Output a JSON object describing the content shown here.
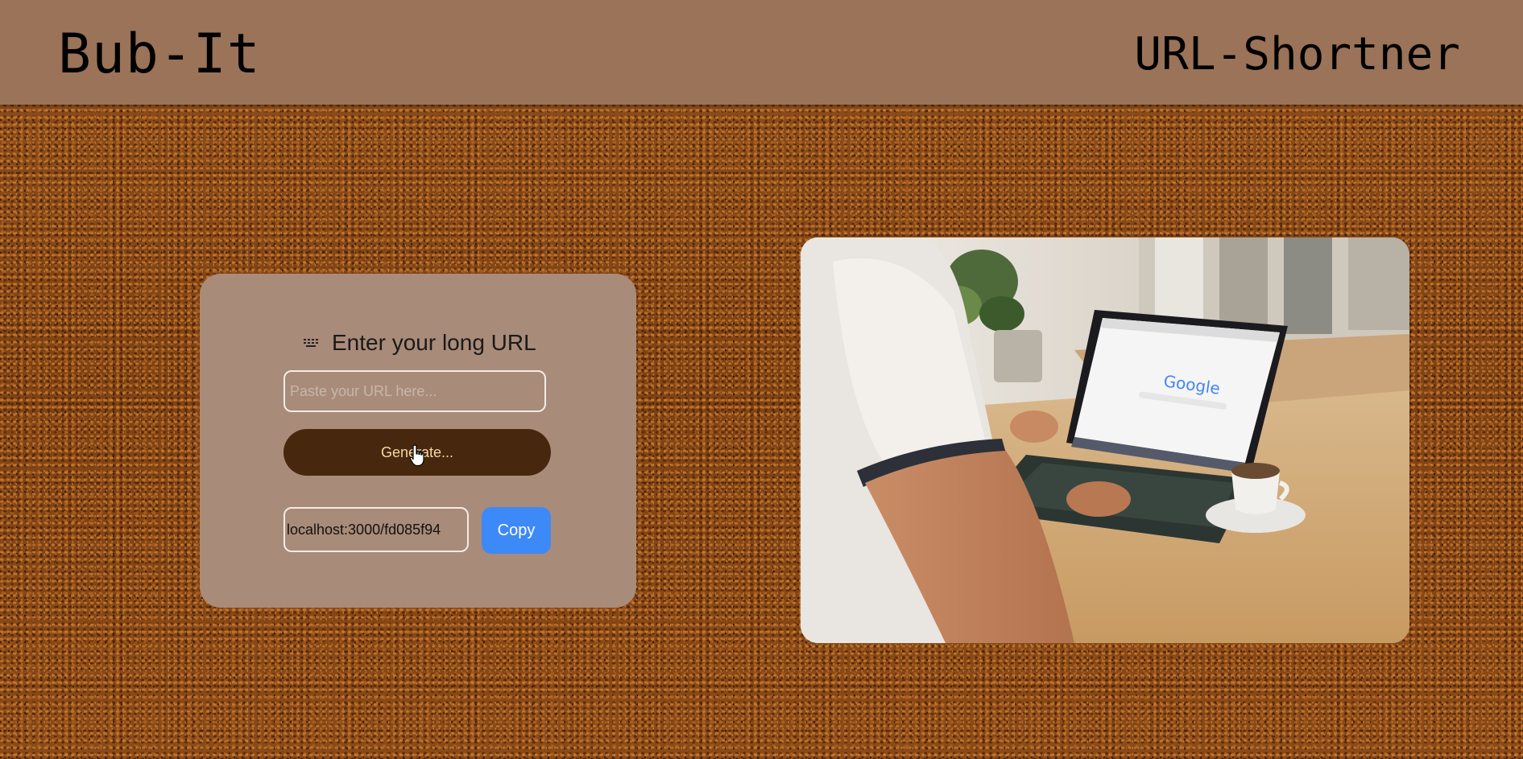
{
  "header": {
    "brand": "Bub-It",
    "tagline": "URL-Shortner"
  },
  "form": {
    "heading_icon": "keyboard-icon",
    "heading": "Enter your long URL",
    "url_input": {
      "placeholder": "Paste your URL here...",
      "value": ""
    },
    "generate_label": "Generate...",
    "short_url": "localhost:3000/fd085f94",
    "copy_label": "Copy"
  },
  "hero_image": {
    "depicts": "person typing on a laptop showing Google search at a wooden desk with a coffee cup and plants"
  },
  "colors": {
    "header_bg": "#9a7358",
    "card_bg": "#a98b79",
    "generate_bg": "#47270e",
    "generate_text": "#f2d9a3",
    "copy_bg": "#3d89f7"
  }
}
